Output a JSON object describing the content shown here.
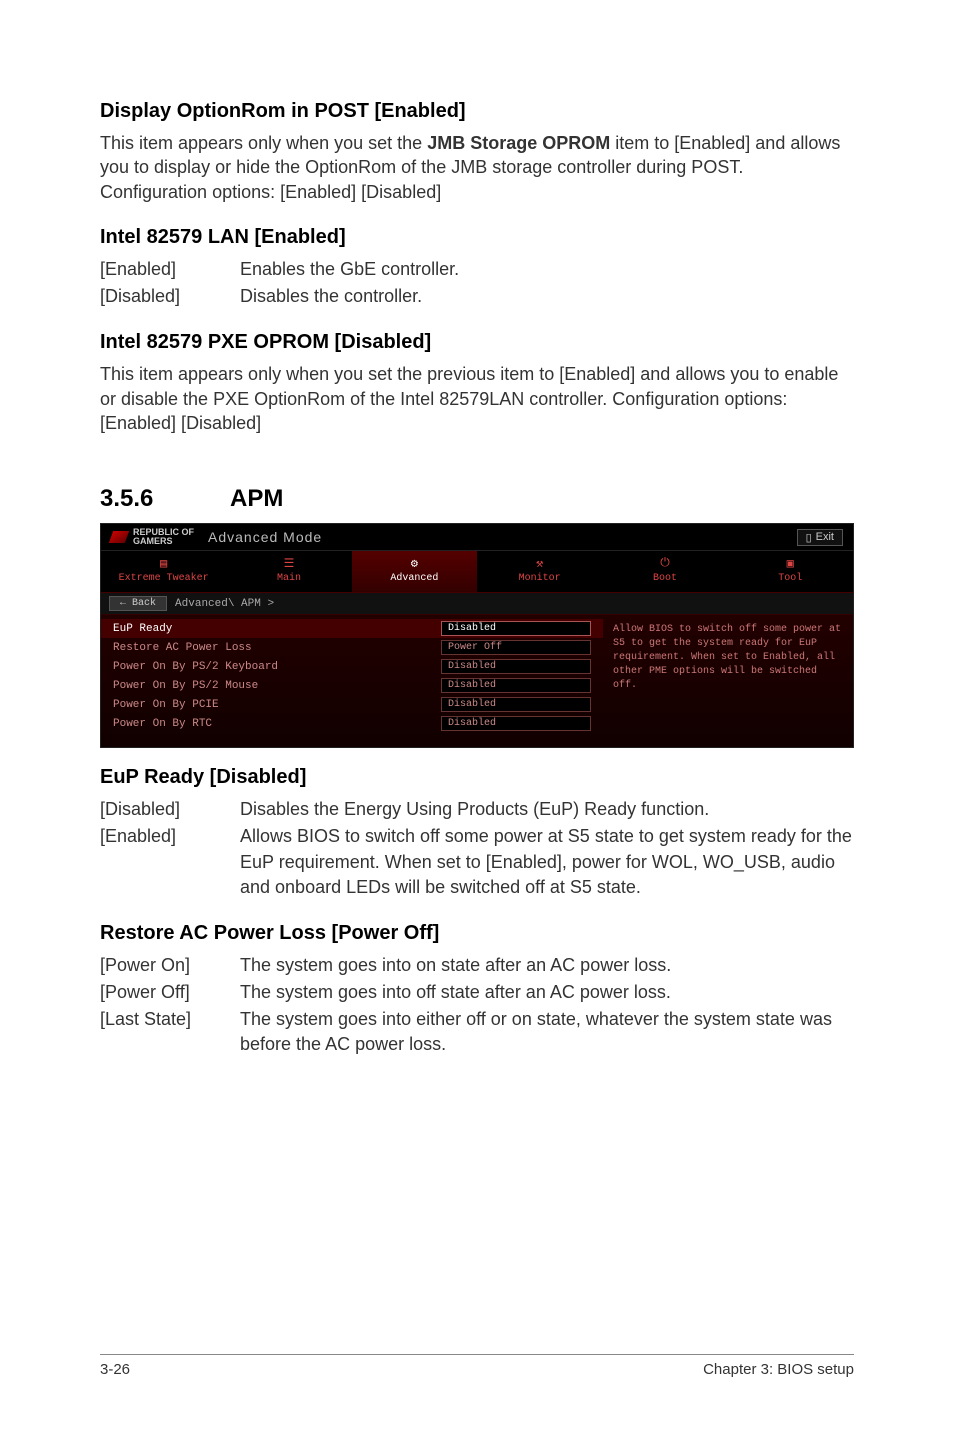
{
  "s1": {
    "h": "Display OptionRom in POST [Enabled]",
    "p_a": "This item appears only when you set the ",
    "p_b": "JMB Storage OPROM",
    "p_c": " item to [Enabled] and allows you to display or hide the OptionRom of the JMB storage controller during POST. Configuration options: [Enabled] [Disabled]"
  },
  "s2": {
    "h": "Intel 82579 LAN [Enabled]",
    "rows": [
      {
        "k": "[Enabled]",
        "v": "Enables the GbE controller."
      },
      {
        "k": "[Disabled]",
        "v": "Disables the controller."
      }
    ]
  },
  "s3": {
    "h": "Intel 82579 PXE OPROM [Disabled]",
    "p": "This item appears only when you set the previous item to [Enabled] and allows you to enable or disable the PXE OptionRom of the Intel 82579LAN controller. Configuration options: [Enabled] [Disabled]"
  },
  "sec": {
    "num": "3.5.6",
    "title": "APM"
  },
  "bios": {
    "brand1": "REPUBLIC OF",
    "brand2": "GAMERS",
    "mode": "Advanced Mode",
    "exit": "Exit",
    "tabs": [
      "Extreme Tweaker",
      "Main",
      "Advanced",
      "Monitor",
      "Boot",
      "Tool"
    ],
    "back": "Back",
    "crumb": "Advanced\\ APM >",
    "rows": [
      {
        "label": "EuP Ready",
        "val": "Disabled",
        "sel": true
      },
      {
        "label": "Restore AC Power Loss",
        "val": "Power Off"
      },
      {
        "label": "Power On By PS/2 Keyboard",
        "val": "Disabled"
      },
      {
        "label": "Power On By PS/2 Mouse",
        "val": "Disabled"
      },
      {
        "label": "Power On By PCIE",
        "val": "Disabled"
      },
      {
        "label": "Power On By RTC",
        "val": "Disabled"
      }
    ],
    "help": "Allow BIOS to switch off some power at S5 to get the system ready for EuP requirement. When set to Enabled, all other PME options will be switched off."
  },
  "s4": {
    "h": "EuP Ready [Disabled]",
    "rows": [
      {
        "k": "[Disabled]",
        "v": "Disables the Energy Using Products (EuP) Ready function."
      },
      {
        "k": "[Enabled]",
        "v": "Allows BIOS to switch off some power at S5 state to get system ready for the EuP requirement. When set to [Enabled], power for WOL, WO_USB, audio and onboard LEDs will be switched off at S5 state."
      }
    ]
  },
  "s5": {
    "h": "Restore AC Power Loss [Power Off]",
    "rows": [
      {
        "k": "[Power On]",
        "v": "The system goes into on state after an AC power loss."
      },
      {
        "k": "[Power Off]",
        "v": "The system goes into off state after an AC power loss."
      },
      {
        "k": "[Last State]",
        "v": "The system goes into either off or on state, whatever the system state was before the AC power loss."
      }
    ]
  },
  "footer": {
    "l": "3-26",
    "r": "Chapter 3: BIOS setup"
  }
}
